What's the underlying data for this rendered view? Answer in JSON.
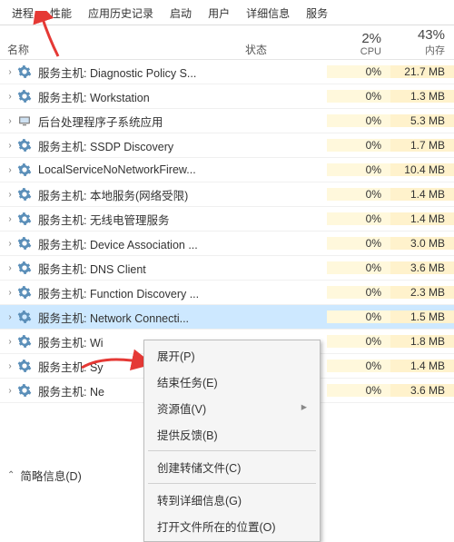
{
  "tabs": [
    "进程",
    "性能",
    "应用历史记录",
    "启动",
    "用户",
    "详细信息",
    "服务"
  ],
  "activeTab": 0,
  "columns": {
    "name": "名称",
    "status": "状态",
    "cpu": "CPU",
    "mem": "内存"
  },
  "totals": {
    "cpu": "2%",
    "mem": "43%"
  },
  "processes": [
    {
      "name": "服务主机: Diagnostic Policy S...",
      "cpu": "0%",
      "mem": "21.7 MB",
      "icon": "gear"
    },
    {
      "name": "服务主机: Workstation",
      "cpu": "0%",
      "mem": "1.3 MB",
      "icon": "gear"
    },
    {
      "name": "后台处理程序子系统应用",
      "cpu": "0%",
      "mem": "5.3 MB",
      "icon": "svc"
    },
    {
      "name": "服务主机: SSDP Discovery",
      "cpu": "0%",
      "mem": "1.7 MB",
      "icon": "gear"
    },
    {
      "name": "LocalServiceNoNetworkFirew...",
      "cpu": "0%",
      "mem": "10.4 MB",
      "icon": "gear"
    },
    {
      "name": "服务主机: 本地服务(网络受限)",
      "cpu": "0%",
      "mem": "1.4 MB",
      "icon": "gear"
    },
    {
      "name": "服务主机: 无线电管理服务",
      "cpu": "0%",
      "mem": "1.4 MB",
      "icon": "gear"
    },
    {
      "name": "服务主机: Device Association ...",
      "cpu": "0%",
      "mem": "3.0 MB",
      "icon": "gear"
    },
    {
      "name": "服务主机: DNS Client",
      "cpu": "0%",
      "mem": "3.6 MB",
      "icon": "gear"
    },
    {
      "name": "服务主机: Function Discovery ...",
      "cpu": "0%",
      "mem": "2.3 MB",
      "icon": "gear"
    },
    {
      "name": "服务主机: Network Connecti...",
      "cpu": "0%",
      "mem": "1.5 MB",
      "icon": "gear",
      "selected": true
    },
    {
      "name": "服务主机: Wi",
      "cpu": "0%",
      "mem": "1.8 MB",
      "icon": "gear"
    },
    {
      "name": "服务主机: Sy",
      "cpu": "0%",
      "mem": "1.4 MB",
      "icon": "gear"
    },
    {
      "name": "服务主机: Ne",
      "cpu": "0%",
      "mem": "3.6 MB",
      "icon": "gear"
    }
  ],
  "menu": {
    "expand": "展开(P)",
    "end": "结束任务(E)",
    "resource": "资源值(V)",
    "feedback": "提供反馈(B)",
    "dump": "创建转储文件(C)",
    "details": "转到详细信息(G)",
    "location": "打开文件所在的位置(O)"
  },
  "footer": "简略信息(D)"
}
